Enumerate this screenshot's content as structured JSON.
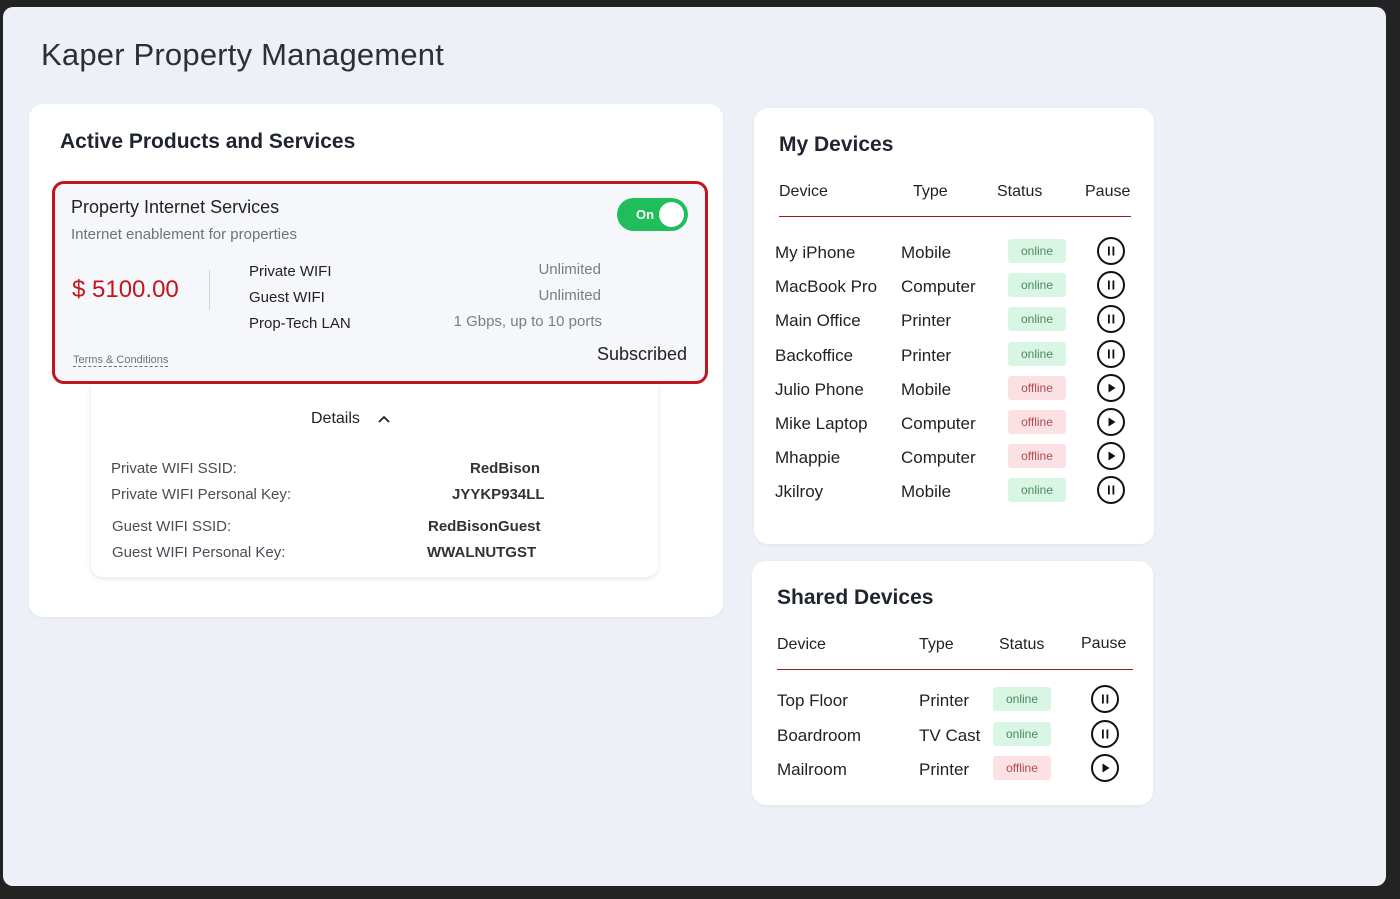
{
  "page": {
    "title": "Kaper Property Management"
  },
  "colors": {
    "accent_red": "#c0161d",
    "toggle_green": "#1fbe5b",
    "online_bg": "#d9f5e4",
    "offline_bg": "#fbe1e3"
  },
  "active": {
    "title": "Active Products and Services",
    "product": {
      "name": "Property Internet Services",
      "description": "Internet enablement for properties",
      "toggle_label": "On",
      "price": "$ 5100.00",
      "features": [
        {
          "name": "Private WIFI",
          "value": "Unlimited"
        },
        {
          "name": "Guest WIFI",
          "value": "Unlimited"
        },
        {
          "name": "Prop-Tech LAN",
          "value": "1 Gbps, up to 10 ports"
        }
      ],
      "terms_label": "Terms & Conditions",
      "status": "Subscribed"
    },
    "details": {
      "toggle_label": "Details",
      "rows": [
        {
          "label": "Private WIFI SSID:",
          "value": "RedBison"
        },
        {
          "label": "Private WIFI Personal Key:",
          "value": "JYYKP934LL"
        },
        {
          "label": "Guest WIFI SSID:",
          "value": "RedBisonGuest"
        },
        {
          "label": "Guest WIFI Personal Key:",
          "value": "WWALNUTGST"
        }
      ]
    }
  },
  "my_devices": {
    "title": "My Devices",
    "headers": [
      "Device",
      "Type",
      "Status",
      "Pause"
    ],
    "rows": [
      {
        "device": "My iPhone",
        "type": "Mobile",
        "status": "online",
        "action": "pause"
      },
      {
        "device": "MacBook Pro",
        "type": "Computer",
        "status": "online",
        "action": "pause"
      },
      {
        "device": "Main Office",
        "type": "Printer",
        "status": "online",
        "action": "pause"
      },
      {
        "device": "Backoffice",
        "type": "Printer",
        "status": "online",
        "action": "pause"
      },
      {
        "device": "Julio Phone",
        "type": "Mobile",
        "status": "offline",
        "action": "play"
      },
      {
        "device": "Mike Laptop",
        "type": "Computer",
        "status": "offline",
        "action": "play"
      },
      {
        "device": "Mhappie",
        "type": "Computer",
        "status": "offline",
        "action": "play"
      },
      {
        "device": "Jkilroy",
        "type": "Mobile",
        "status": "online",
        "action": "pause"
      }
    ]
  },
  "shared_devices": {
    "title": "Shared Devices",
    "headers": [
      "Device",
      "Type",
      "Status",
      "Pause"
    ],
    "rows": [
      {
        "device": "Top Floor",
        "type": "Printer",
        "status": "online",
        "action": "pause"
      },
      {
        "device": "Boardroom",
        "type": "TV Cast",
        "status": "online",
        "action": "pause"
      },
      {
        "device": "Mailroom",
        "type": "Printer",
        "status": "offline",
        "action": "play"
      }
    ]
  }
}
